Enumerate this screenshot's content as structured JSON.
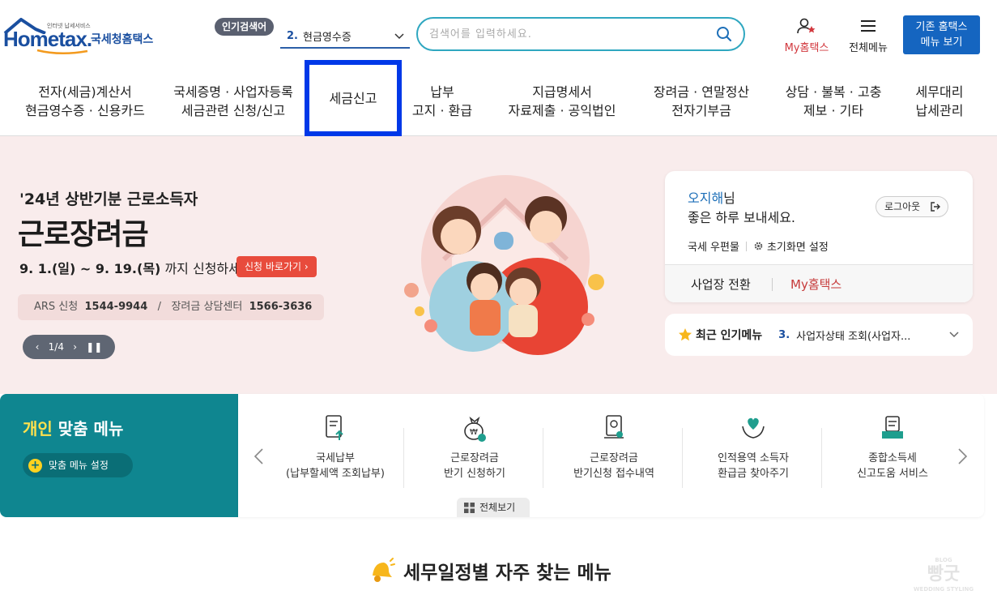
{
  "header": {
    "logo": {
      "small_text": "인터넷 납세서비스",
      "brand": "Hometax.",
      "service_name": "국세청홈택스"
    },
    "popular": {
      "badge": "인기검색어",
      "rank": "2.",
      "term": "현금영수증"
    },
    "search": {
      "placeholder": "검색어를 입력하세요."
    },
    "my_hometax_label": "My홈택스",
    "all_menu_label": "전체메뉴",
    "legacy_button": {
      "line1": "기존 홈택스",
      "line2": "메뉴 보기"
    }
  },
  "gnb": [
    {
      "line1": "전자(세금)계산서",
      "line2": "현금영수증 · 신용카드"
    },
    {
      "line1": "국세증명 · 사업자등록",
      "line2": "세금관련 신청/신고"
    },
    {
      "line1": "세금신고",
      "line2": "",
      "active": true
    },
    {
      "line1": "납부",
      "line2": "고지 · 환급"
    },
    {
      "line1": "지급명세서",
      "line2": "자료제출 · 공익법인"
    },
    {
      "line1": "장려금 · 연말정산",
      "line2": "전자기부금"
    },
    {
      "line1": "상담 · 불복 · 고충",
      "line2": "제보 · 기타"
    },
    {
      "line1": "세무대리",
      "line2": "납세관리"
    }
  ],
  "banner": {
    "subtitle": "'24년 상반기분 근로소득자",
    "title": "근로장려금",
    "period": "9. 1.(일) ~ 9. 19.(목)",
    "period_suffix": "까지 신청하세요!",
    "apply_button": "신청 바로가기",
    "ars_label": "ARS 신청",
    "ars_number": "1544-9944",
    "center_label": "장려금 상담센터",
    "center_number": "1566-3636",
    "pager": "1/4"
  },
  "user_card": {
    "name": "오지해",
    "suffix": "님",
    "greeting": "좋은 하루 보내세요.",
    "logout": "로그아웃",
    "mailbox": "국세 우편물",
    "init_setting": "초기화면 설정",
    "switch_business": "사업장 전환",
    "my_hometax": "My홈택스"
  },
  "recent_menu": {
    "title": "최근 인기메뉴",
    "rank": "3.",
    "item": "사업자상태 조회(사업자..."
  },
  "personal_menu": {
    "title_highlight": "개인",
    "title_rest": " 맞춤 메뉴",
    "setting_button": "맞춤 메뉴 설정",
    "items": [
      {
        "line1": "국세납부",
        "line2": "(납부할세액 조회납부)",
        "icon": "document-upload-icon"
      },
      {
        "line1": "근로장려금",
        "line2": "반기 신청하기",
        "icon": "money-bag-icon"
      },
      {
        "line1": "근로장려금",
        "line2": "반기신청 접수내역",
        "icon": "certificate-icon"
      },
      {
        "line1": "인적용역 소득자",
        "line2": "환급금 찾아주기",
        "icon": "heart-hands-icon"
      },
      {
        "line1": "종합소득세",
        "line2": "신고도움 서비스",
        "icon": "tray-document-icon"
      }
    ],
    "view_all": "전체보기"
  },
  "schedule": {
    "title": "세무일정별 자주 찾는 메뉴"
  },
  "watermark": {
    "top": "BLOG",
    "main": "빵굿",
    "bottom": "WEDDING STYLING"
  },
  "colors": {
    "brand_blue": "#1a4fa0",
    "teal": "#0f8690",
    "accent_red": "#e84b3c",
    "active_border": "#0038e8",
    "banner_bg": "#f9ecec"
  }
}
